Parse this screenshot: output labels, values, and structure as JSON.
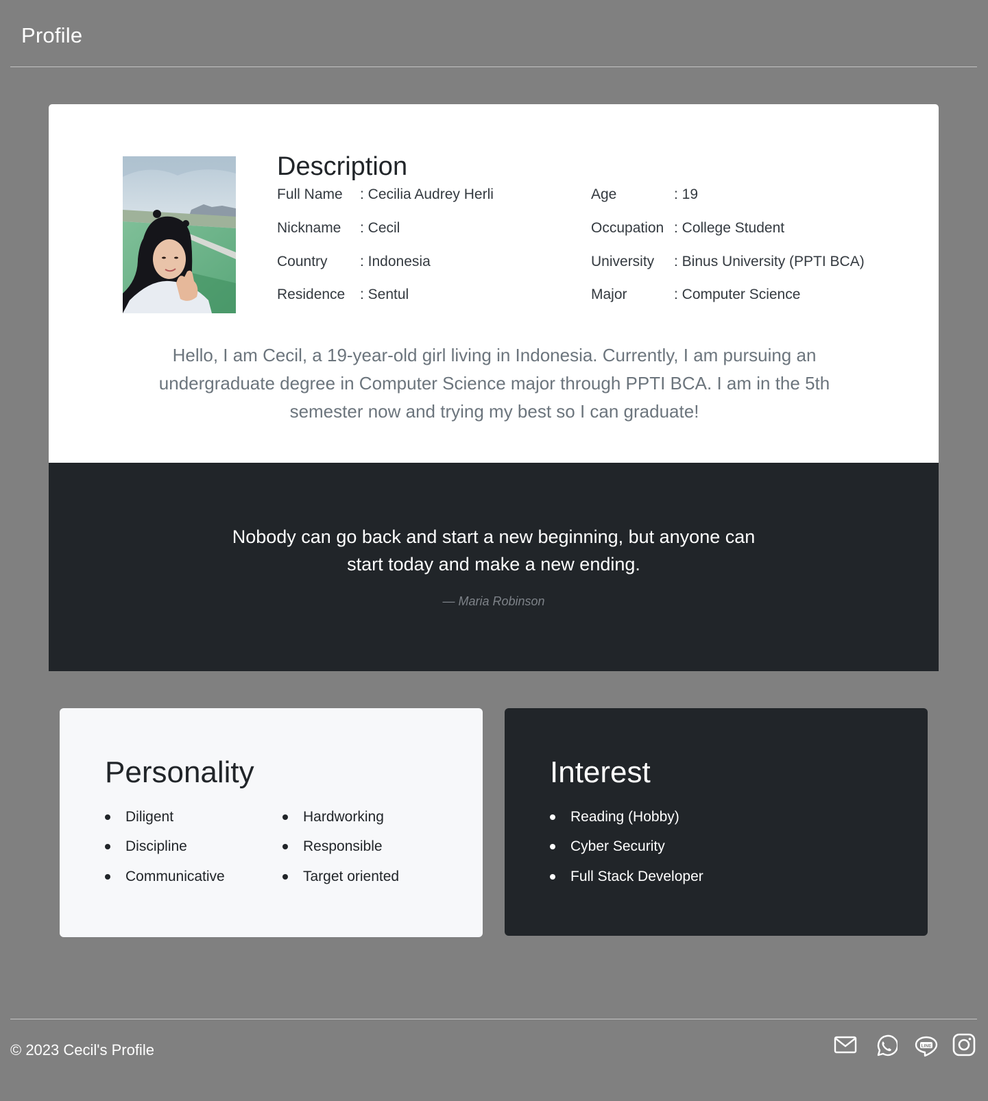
{
  "header": {
    "title": "Profile"
  },
  "description": {
    "title": "Description",
    "left": [
      {
        "label": "Full Name",
        "value": ": Cecilia Audrey Herli"
      },
      {
        "label": "Nickname",
        "value": ": Cecil"
      },
      {
        "label": "Country",
        "value": ": Indonesia"
      },
      {
        "label": "Residence",
        "value": ": Sentul"
      }
    ],
    "right": [
      {
        "label": "Age",
        "value": ": 19"
      },
      {
        "label": "Occupation",
        "value": ": College Student"
      },
      {
        "label": "University",
        "value": ": Binus University (PPTI BCA)"
      },
      {
        "label": "Major",
        "value": ": Computer Science"
      }
    ],
    "bio": "Hello, I am Cecil, a 19-year-old girl living in Indonesia. Currently, I am pursuing an undergraduate degree in Computer Science major through PPTI BCA. I am in the 5th semester now and trying my best so I can graduate!"
  },
  "quote": {
    "text": "Nobody can go back and start a new beginning, but anyone can start today and make a new ending.",
    "author": "— Maria Robinson"
  },
  "personality": {
    "title": "Personality",
    "col1": [
      "Diligent",
      "Discipline",
      "Communicative"
    ],
    "col2": [
      "Hardworking",
      "Responsible",
      "Target oriented"
    ]
  },
  "interest": {
    "title": "Interest",
    "items": [
      "Reading (Hobby)",
      "Cyber Security",
      "Full Stack Developer"
    ]
  },
  "footer": {
    "copyright": "© 2023 Cecil's Profile",
    "icons": [
      "mail-icon",
      "whatsapp-icon",
      "line-icon",
      "instagram-icon"
    ]
  }
}
